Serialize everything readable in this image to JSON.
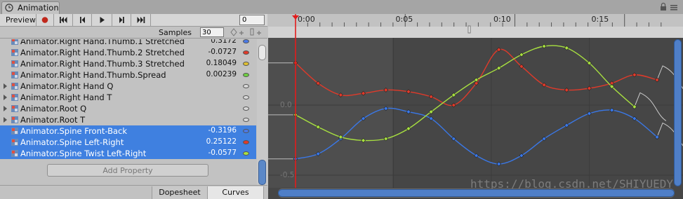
{
  "window": {
    "tab_title": "Animation"
  },
  "toolbar": {
    "preview_label": "Preview",
    "frame_value": "0",
    "samples_label": "Samples",
    "samples_value": "30"
  },
  "properties": [
    {
      "name": "Animator.Right Hand.Thumb.1 Stretched",
      "value": "0.3172",
      "dot_color": "#4a7ae8",
      "foldable": false,
      "selected": false
    },
    {
      "name": "Animator.Right Hand.Thumb.2 Stretched",
      "value": "-0.0727",
      "dot_color": "#e03a2a",
      "foldable": false,
      "selected": false
    },
    {
      "name": "Animator.Right Hand.Thumb.3 Stretched",
      "value": "0.18049",
      "dot_color": "#e0c030",
      "foldable": false,
      "selected": false
    },
    {
      "name": "Animator.Right Hand.Thumb.Spread",
      "value": "0.00239",
      "dot_color": "#6ed040",
      "foldable": false,
      "selected": false
    },
    {
      "name": "Animator.Right Hand Q",
      "value": "",
      "dot_color": "#d8d8d8",
      "foldable": true,
      "selected": false
    },
    {
      "name": "Animator.Right Hand T",
      "value": "",
      "dot_color": "#d8d8d8",
      "foldable": true,
      "selected": false
    },
    {
      "name": "Animator.Root Q",
      "value": "",
      "dot_color": "#d8d8d8",
      "foldable": true,
      "selected": false
    },
    {
      "name": "Animator.Root T",
      "value": "",
      "dot_color": "#d8d8d8",
      "foldable": true,
      "selected": false
    },
    {
      "name": "Animator.Spine Front-Back",
      "value": "-0.3196",
      "dot_color": "#4a7ae8",
      "foldable": false,
      "selected": true
    },
    {
      "name": "Animator.Spine Left-Right",
      "value": "0.25122",
      "dot_color": "#e03a2a",
      "foldable": false,
      "selected": true
    },
    {
      "name": "Animator.Spine Twist Left-Right",
      "value": "-0.0577",
      "dot_color": "#a8e040",
      "foldable": false,
      "selected": true
    }
  ],
  "add_property_label": "Add Property",
  "mode_tabs": {
    "dopesheet": "Dopesheet",
    "curves": "Curves"
  },
  "timeline": {
    "ticks": [
      "0:00",
      "0:05",
      "0:10",
      "0:15"
    ],
    "value_labels": [
      "0.0",
      "-0.5"
    ]
  },
  "curves": [
    {
      "name": "Spine Front-Back",
      "color": "#3a78e8",
      "keys": [
        [
          0,
          -0.3196
        ],
        [
          1,
          -0.29
        ],
        [
          2,
          -0.2
        ],
        [
          3,
          -0.08
        ],
        [
          4,
          -0.02
        ],
        [
          5,
          -0.04
        ],
        [
          6,
          -0.08
        ],
        [
          7,
          -0.2
        ],
        [
          8,
          -0.3
        ],
        [
          9,
          -0.35
        ],
        [
          10,
          -0.3
        ],
        [
          11,
          -0.2
        ],
        [
          12,
          -0.12
        ],
        [
          13,
          -0.05
        ],
        [
          14,
          -0.03
        ],
        [
          15,
          -0.08
        ],
        [
          16,
          -0.19
        ]
      ]
    },
    {
      "name": "Spine Left-Right",
      "color": "#e03a2a",
      "keys": [
        [
          0,
          0.25122
        ],
        [
          1,
          0.13
        ],
        [
          2,
          0.06
        ],
        [
          3,
          0.07
        ],
        [
          4,
          0.09
        ],
        [
          5,
          0.08
        ],
        [
          6,
          0.05
        ],
        [
          7,
          0.0
        ],
        [
          8,
          0.13
        ],
        [
          9,
          0.33
        ],
        [
          10,
          0.23
        ],
        [
          11,
          0.12
        ],
        [
          12,
          0.09
        ],
        [
          13,
          0.1
        ],
        [
          14,
          0.13
        ],
        [
          15,
          0.18
        ],
        [
          16,
          0.15
        ]
      ]
    },
    {
      "name": "Spine Twist Left-Right",
      "color": "#a8e040",
      "keys": [
        [
          0,
          -0.0577
        ],
        [
          1,
          -0.13
        ],
        [
          2,
          -0.19
        ],
        [
          3,
          -0.21
        ],
        [
          4,
          -0.2
        ],
        [
          5,
          -0.14
        ],
        [
          6,
          -0.04
        ],
        [
          7,
          0.06
        ],
        [
          8,
          0.15
        ],
        [
          9,
          0.22
        ],
        [
          10,
          0.3
        ],
        [
          11,
          0.35
        ],
        [
          12,
          0.34
        ],
        [
          13,
          0.25
        ],
        [
          14,
          0.11
        ],
        [
          15,
          -0.01
        ]
      ]
    }
  ],
  "watermark": "https://blog.csdn.net/SHIYUEDY"
}
